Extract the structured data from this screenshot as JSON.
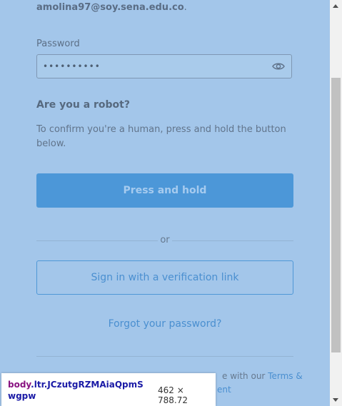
{
  "account": {
    "email": "amolina97@soy.sena.edu.co",
    "email_suffix": "."
  },
  "password": {
    "label": "Password",
    "value": "••••••••••",
    "toggle_icon": "eye-icon"
  },
  "robot": {
    "title": "Are you a robot?",
    "description": "To confirm you're a human, press and hold the button below.",
    "hold_button": "Press and hold"
  },
  "divider": {
    "or": "or"
  },
  "verification_link_button": "Sign in with a verification link",
  "forgot_password": "Forgot your password?",
  "terms": {
    "text_pre": "e with our",
    "link_terms": "Terms &",
    "link_second": "ent"
  },
  "devtools_tooltip": {
    "tag": "body",
    "class": ".ltr.JCzutgRZMAiaQpmSwgpw",
    "size": "462 × 788.72"
  },
  "colors": {
    "background": "#a3c6ea",
    "primary_button": "#4c97d8",
    "link": "#4a8fd0"
  }
}
